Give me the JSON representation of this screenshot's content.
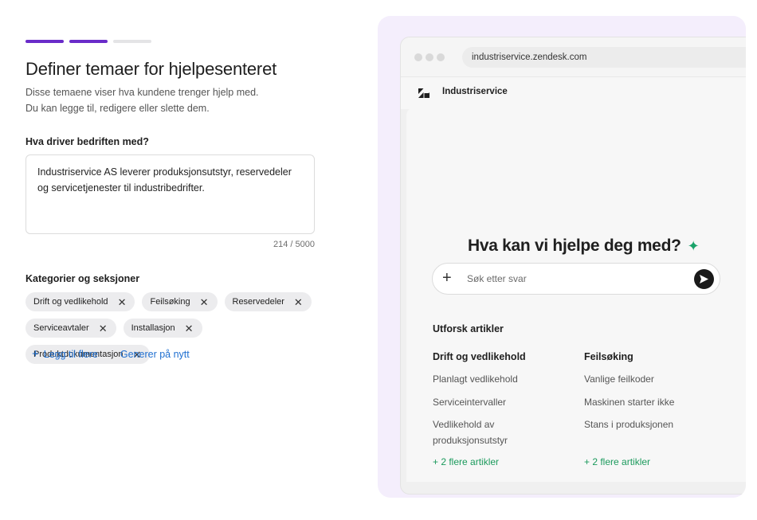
{
  "progress": {
    "total": 3,
    "current": 2
  },
  "form": {
    "title": "Definer temaer for hjelpesenteret",
    "subtitle_line1": "Disse temaene viser hva kundene trenger hjelp med.",
    "subtitle_line2": "Du kan legge til, redigere eller slette dem.",
    "business_label": "Hva driver bedriften med?",
    "business_value": "Industriservice AS leverer produksjonsutstyr, reservedeler og servicetjenester til industribedrifter.",
    "char_counter": "214 / 5000",
    "categories_label": "Kategorier og seksjoner",
    "chips": [
      "Drift og vedlikehold",
      "Feilsøking",
      "Reservedeler",
      "Serviceavtaler",
      "Installasjon",
      "Produktdokumentasjon"
    ],
    "add_more_label": "Legg til flere",
    "regenerate_label": "Generer på nytt"
  },
  "preview": {
    "url": "industriservice.zendesk.com",
    "brand_name": "Industriservice",
    "hero_title": "Hva kan vi hjelpe deg med?",
    "search_placeholder": "Søk etter svar",
    "explore_title": "Utforsk artikler",
    "columns": [
      {
        "title": "Drift og vedlikehold",
        "articles": [
          "Planlagt vedlikehold",
          "Serviceintervaller",
          "Vedlikehold av produksjonsutstyr"
        ],
        "more": "+ 2 flere artikler"
      },
      {
        "title": "Feilsøking",
        "articles": [
          "Vanlige feilkoder",
          "Maskinen starter ikke",
          "Stans i produksjonen"
        ],
        "more": "+ 2 flere artikler"
      }
    ]
  },
  "colors": {
    "accent": "#6a2cc9",
    "link": "#1f6fd0",
    "success": "#1b9a5c",
    "preview_bg": "#f4eefc"
  }
}
